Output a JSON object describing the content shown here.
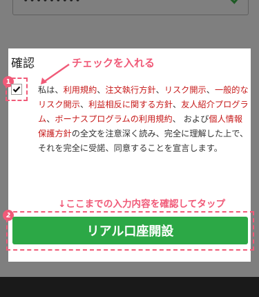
{
  "password_field": {
    "value": "•••••••••"
  },
  "confirm": {
    "title": "確認"
  },
  "annotations": {
    "check_hint": "チェックを入れる",
    "tap_hint": "↓ここまでの入力内容を確認してタップ",
    "step1": "1",
    "step2": "2"
  },
  "terms": {
    "p1": "私は、",
    "l1": "利用規約",
    "s1": "、",
    "l2": "注文執行方針",
    "s2": "、",
    "l3": "リスク開示",
    "s3": "、",
    "l4": "一般的なリスク開示",
    "s4": "、",
    "l5": "利益相反に関する方針",
    "s5": "、",
    "l6": "友人紹介プログラム",
    "s6": "、",
    "l7": "ボーナスプログラムの利用規約",
    "s7": "、 および",
    "l8": "個人情報保護方針",
    "p2": "の全文を注意深く読み、完全に理解した上で、それを完全に受諾、同意することを宣言します。"
  },
  "button": {
    "label": "リアル口座開設"
  },
  "colors": {
    "accent": "#f05a78",
    "button": "#2ca846",
    "link": "#c61a1a"
  }
}
